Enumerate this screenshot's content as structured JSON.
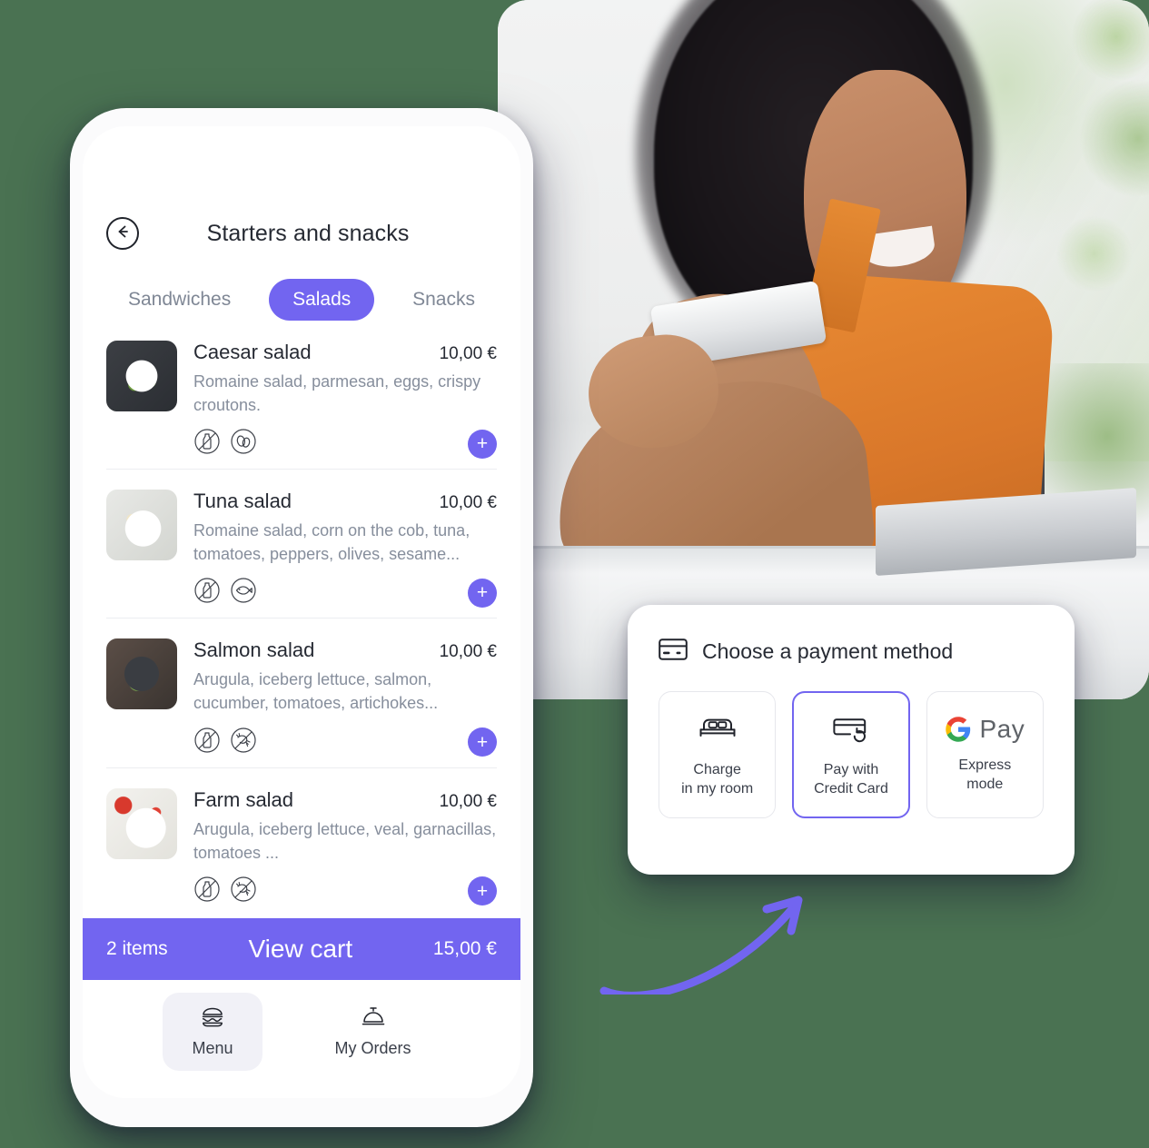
{
  "background_color": "#4a7252",
  "accent_color": "#7265f0",
  "phone": {
    "header": {
      "back_icon": "arrow-left-circle-icon",
      "title": "Starters and snacks"
    },
    "tabs": [
      {
        "label": "Sandwiches",
        "active": false
      },
      {
        "label": "Salads",
        "active": true
      },
      {
        "label": "Snacks",
        "active": false
      }
    ],
    "menu_items": [
      {
        "name": "Caesar salad",
        "price": "10,00 €",
        "description": "Romaine salad, parmesan, eggs, crispy croutons.",
        "thumb_class": "caesar",
        "allergens": [
          "no-lactose-icon",
          "eggs-icon"
        ],
        "add_label": "+"
      },
      {
        "name": "Tuna salad",
        "price": "10,00 €",
        "description": "Romaine salad, corn on the cob, tuna, tomatoes, peppers, olives, sesame...",
        "thumb_class": "tuna",
        "allergens": [
          "no-lactose-icon",
          "fish-icon"
        ],
        "add_label": "+"
      },
      {
        "name": "Salmon salad",
        "price": "10,00 €",
        "description": "Arugula, iceberg lettuce, salmon, cucumber, tomatoes, artichokes...",
        "thumb_class": "salmon",
        "allergens": [
          "no-lactose-icon",
          "no-shellfish-icon"
        ],
        "add_label": "+"
      },
      {
        "name": "Farm salad",
        "price": "10,00 €",
        "description": "Arugula, iceberg lettuce, veal, garnacillas, tomatoes ...",
        "thumb_class": "farm",
        "allergens": [
          "no-lactose-icon",
          "no-shellfish-icon"
        ],
        "add_label": "+"
      }
    ],
    "cart_bar": {
      "count": "2 items",
      "cta": "View cart",
      "total": "15,00 €"
    },
    "bottom_nav": [
      {
        "label": "Menu",
        "icon": "burger-icon",
        "active": true
      },
      {
        "label": "My Orders",
        "icon": "room-service-bell-icon",
        "active": false
      }
    ]
  },
  "payment_card": {
    "header_icon": "credit-card-icon",
    "title": "Choose a payment method",
    "options": [
      {
        "label": "Charge\nin my room",
        "line1": "Charge",
        "line2": "in my room",
        "icon": "bed-icon",
        "selected": false
      },
      {
        "label": "Pay with\nCredit Card",
        "line1": "Pay with",
        "line2": "Credit Card",
        "icon": "credit-card-refresh-icon",
        "selected": true
      },
      {
        "label": "Express\nmode",
        "line1": "Express",
        "line2": "mode",
        "icon": "google-pay-icon",
        "selected": false,
        "brand_text": "Pay"
      }
    ]
  },
  "annotation": {
    "arrow": "curved-arrow-pointing-up-right",
    "arrow_color": "#7265f0"
  }
}
